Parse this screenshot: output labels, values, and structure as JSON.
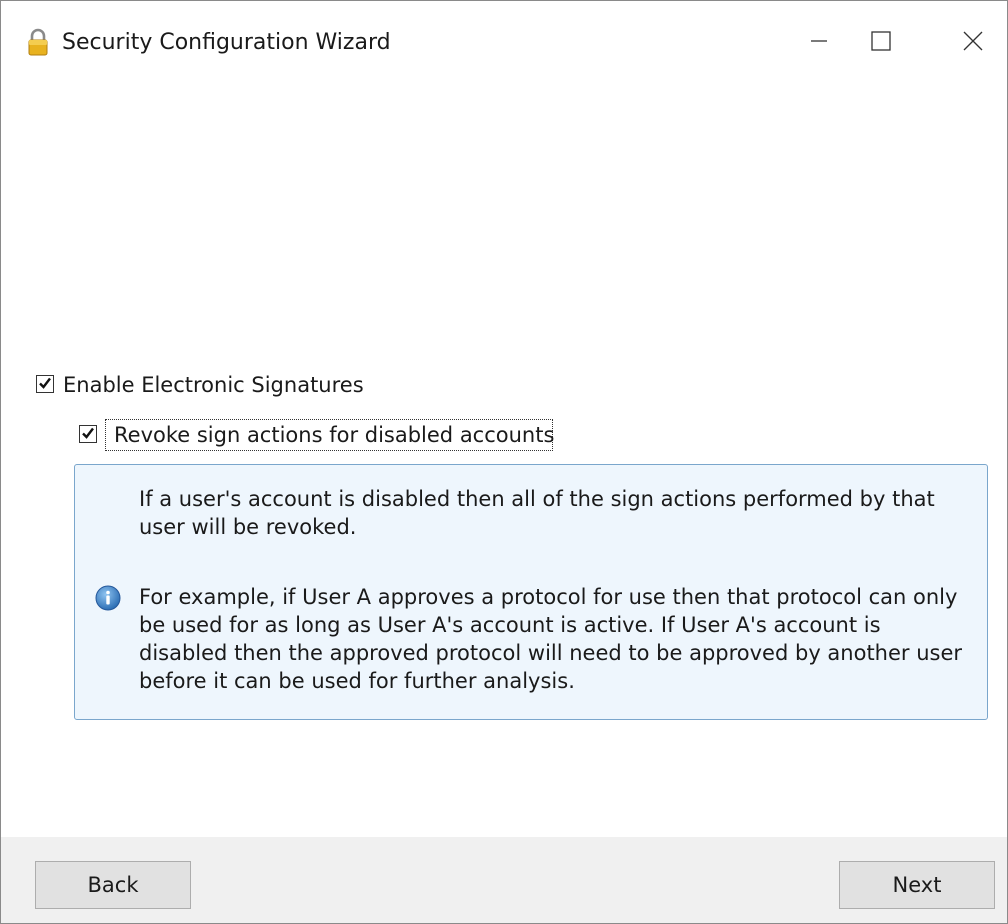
{
  "window": {
    "title": "Security Configuration Wizard",
    "icon": "lock-icon",
    "controls": {
      "minimize": "minimize-icon",
      "maximize": "maximize-icon",
      "close": "close-icon"
    }
  },
  "options": {
    "enable_signatures": {
      "label": "Enable Electronic Signatures",
      "checked": true
    },
    "revoke_disabled": {
      "label": "Revoke sign actions for disabled accounts",
      "checked": true
    }
  },
  "info": {
    "paragraph1": "If a user's account is disabled then all of the sign actions performed by that user will be revoked.",
    "paragraph2": "For example, if User A approves a protocol for use then that protocol can only be used for as long as User A's account is active. If User A's account is disabled then the approved protocol will need to be approved by another user before it can be used for further analysis.",
    "icon": "info-icon"
  },
  "footer": {
    "back_label": "Back",
    "next_label": "Next"
  },
  "colors": {
    "info_background": "#eef6fd",
    "info_border": "#7aa6cc",
    "footer_background": "#f0f0f0",
    "button_background": "#e1e1e1"
  }
}
